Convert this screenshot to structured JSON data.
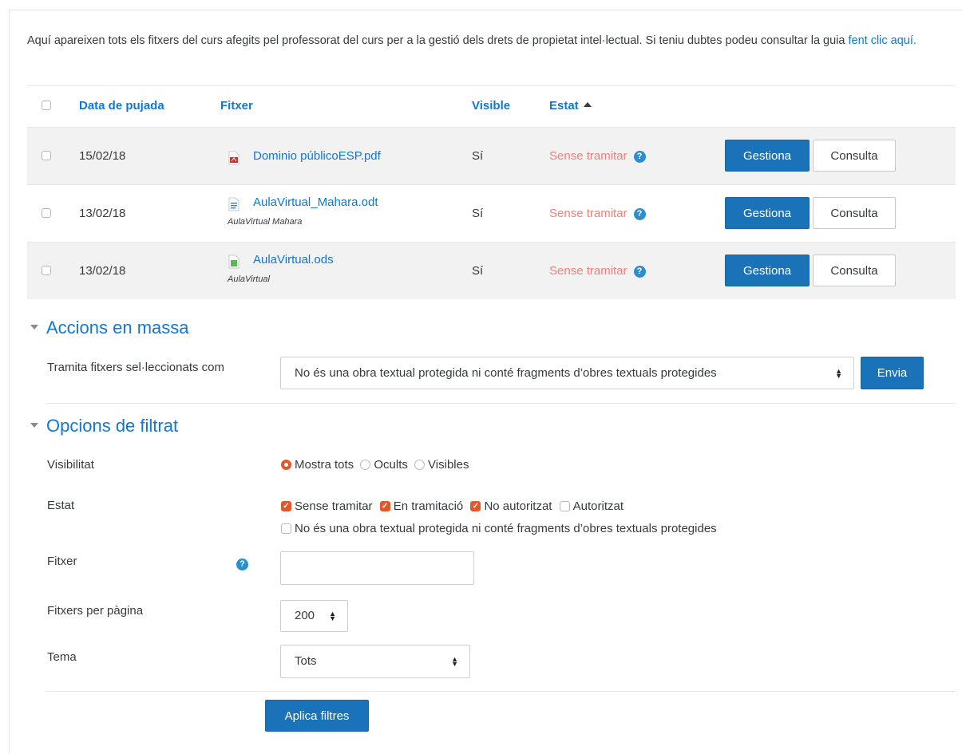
{
  "intro": {
    "text": "Aquí apareixen tots els fitxers del curs afegits pel professorat del curs per a la gestió dels drets de propietat intel·lectual. Si teniu dubtes podeu consultar la guia ",
    "link": "fent clic aquí."
  },
  "table": {
    "headers": {
      "date": "Data de pujada",
      "file": "Fitxer",
      "visible": "Visible",
      "status": "Estat"
    },
    "rows": [
      {
        "date": "15/02/18",
        "file": "Dominio públicoESP.pdf",
        "desc": "",
        "icon": "pdf-file-icon",
        "visible": "Sí",
        "status": "Sense tramitar",
        "manage": "Gestiona",
        "view": "Consulta"
      },
      {
        "date": "13/02/18",
        "file": "AulaVirtual_Mahara.odt",
        "desc": "AulaVirtual Mahara",
        "icon": "document-file-icon",
        "visible": "Sí",
        "status": "Sense tramitar",
        "manage": "Gestiona",
        "view": "Consulta"
      },
      {
        "date": "13/02/18",
        "file": "AulaVirtual.ods",
        "desc": "AulaVirtual",
        "icon": "spreadsheet-file-icon",
        "visible": "Sí",
        "status": "Sense tramitar",
        "manage": "Gestiona",
        "view": "Consulta"
      }
    ]
  },
  "bulk": {
    "title": "Accions en massa",
    "label": "Tramita fitxers sel·leccionats com",
    "select_value": "No és una obra textual protegida ni conté fragments d’obres textuals protegides",
    "submit": "Envia"
  },
  "filters": {
    "title": "Opcions de filtrat",
    "visibility_label": "Visibilitat",
    "visibility_options": [
      "Mostra tots",
      "Ocults",
      "Visibles"
    ],
    "visibility_selected": "Mostra tots",
    "status_label": "Estat",
    "status_options": [
      {
        "label": "Sense tramitar",
        "checked": true
      },
      {
        "label": "En tramitació",
        "checked": true
      },
      {
        "label": "No autoritzat",
        "checked": true
      },
      {
        "label": "Autoritzat",
        "checked": false
      },
      {
        "label": "No és una obra textual protegida ni conté fragments d’obres textuals protegides",
        "checked": false
      }
    ],
    "file_label": "Fitxer",
    "file_value": "",
    "per_page_label": "Fitxers per pàgina",
    "per_page_value": "200",
    "topic_label": "Tema",
    "topic_value": "Tots",
    "apply": "Aplica filtres"
  },
  "colors": {
    "link": "#1177d1",
    "primary_button": "#1a73b9",
    "status_text": "#f0807a",
    "checked_accent": "#e0592a",
    "row_stripe": "#f2f2f2"
  }
}
